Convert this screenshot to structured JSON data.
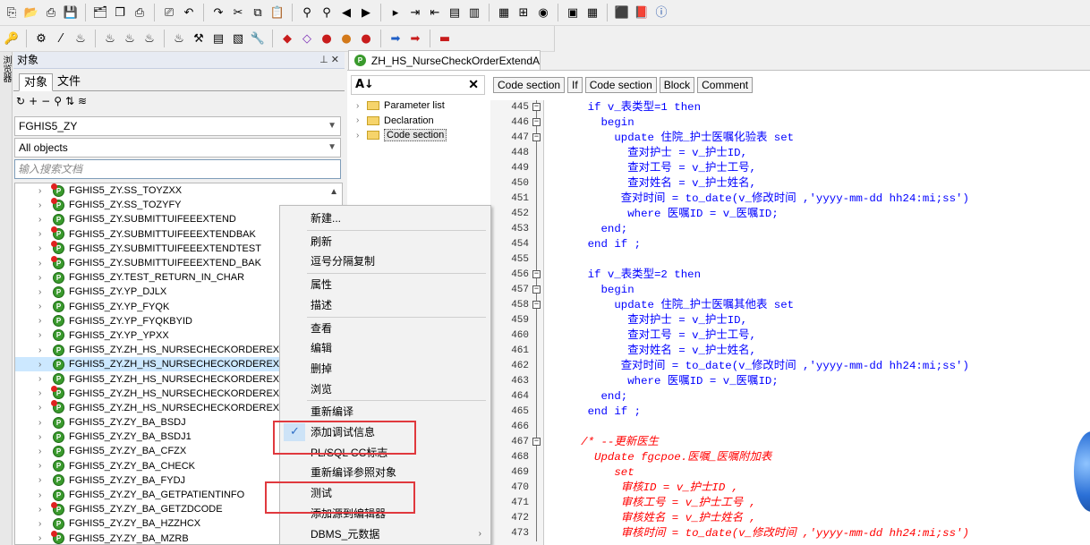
{
  "toolbar_top": {
    "icons": [
      "new-icon",
      "open-icon",
      "print-icon",
      "save-icon",
      "save-all-icon",
      "copy-window-icon",
      "print-preview-icon",
      "print-setup-icon",
      "undo-icon",
      "redo-icon",
      "cut-icon",
      "copy-icon",
      "paste-icon",
      "find-icon",
      "find-next-icon",
      "navigate-back-icon",
      "navigate-forward-icon",
      "execute-icon",
      "indent-icon",
      "unindent-icon",
      "comment-icon",
      "uncomment-icon",
      "describe-icon",
      "query-icon",
      "stop-icon",
      "window-list-icon",
      "tile-icon",
      "oracle-icon",
      "pdf-icon",
      "info-icon"
    ]
  },
  "toolbar_second": {
    "icons": [
      "key-icon",
      "compile-icon",
      "debug-icon",
      "breakpoint-icon",
      "connect-icon",
      "sql-icon",
      "beans-icon",
      "beans2-icon",
      "tools-icon",
      "report-icon",
      "docs-icon",
      "wrench-icon",
      "gem-icon",
      "diamond-icon",
      "ruby-icon",
      "ball-icon",
      "ball2-icon",
      "arrow-right-icon",
      "arrow-right-red-icon",
      "car-icon"
    ]
  },
  "side_tab": {
    "label": "浏览器"
  },
  "object_panel": {
    "title": "对象",
    "pin_icon": "pin-icon",
    "tabs": [
      "对象",
      "文件"
    ],
    "schema": "FGHIS5_ZY",
    "filter": "All objects",
    "search_placeholder": "输入搜索文档",
    "items": [
      {
        "name": "FGHIS5_ZY.SS_TOYZXX",
        "err": true
      },
      {
        "name": "FGHIS5_ZY.SS_TOZYFY",
        "err": true
      },
      {
        "name": "FGHIS5_ZY.SUBMITTUIFEEEXTEND",
        "err": false
      },
      {
        "name": "FGHIS5_ZY.SUBMITTUIFEEEXTENDBAK",
        "err": true
      },
      {
        "name": "FGHIS5_ZY.SUBMITTUIFEEEXTENDTEST",
        "err": true
      },
      {
        "name": "FGHIS5_ZY.SUBMITTUIFEEEXTEND_BAK",
        "err": true
      },
      {
        "name": "FGHIS5_ZY.TEST_RETURN_IN_CHAR",
        "err": false
      },
      {
        "name": "FGHIS5_ZY.YP_DJLX",
        "err": false
      },
      {
        "name": "FGHIS5_ZY.YP_FYQK",
        "err": false
      },
      {
        "name": "FGHIS5_ZY.YP_FYQKBYID",
        "err": false
      },
      {
        "name": "FGHIS5_ZY.YP_YPXX",
        "err": false
      },
      {
        "name": "FGHIS5_ZY.ZH_HS_NURSECHECKORDEREXTEN",
        "err": false
      },
      {
        "name": "FGHIS5_ZY.ZH_HS_NURSECHECKORDEREXTEN",
        "err": false,
        "selected": true
      },
      {
        "name": "FGHIS5_ZY.ZH_HS_NURSECHECKORDEREXTEN",
        "err": false
      },
      {
        "name": "FGHIS5_ZY.ZH_HS_NURSECHECKORDEREXTEN",
        "err": true
      },
      {
        "name": "FGHIS5_ZY.ZH_HS_NURSECHECKORDEREXTEN",
        "err": true
      },
      {
        "name": "FGHIS5_ZY.ZY_BA_BSDJ",
        "err": false
      },
      {
        "name": "FGHIS5_ZY.ZY_BA_BSDJ1",
        "err": false
      },
      {
        "name": "FGHIS5_ZY.ZY_BA_CFZX",
        "err": false
      },
      {
        "name": "FGHIS5_ZY.ZY_BA_CHECK",
        "err": false
      },
      {
        "name": "FGHIS5_ZY.ZY_BA_FYDJ",
        "err": false
      },
      {
        "name": "FGHIS5_ZY.ZY_BA_GETPATIENTINFO",
        "err": false
      },
      {
        "name": "FGHIS5_ZY.ZY_BA_GETZDCODE",
        "err": true
      },
      {
        "name": "FGHIS5_ZY.ZY_BA_HZZHCX",
        "err": false
      },
      {
        "name": "FGHIS5_ZY.ZY_BA_MZRB",
        "err": true
      }
    ]
  },
  "document_tab": {
    "title": "ZH_HS_NurseCheckOrderExtendA"
  },
  "structure": {
    "items": [
      "Parameter list",
      "Declaration",
      "Code section"
    ],
    "selected": 2
  },
  "section_bar": [
    "Code section",
    "If",
    "Code section",
    "Block",
    "Comment"
  ],
  "code": {
    "lines": [
      {
        "n": "445",
        "fold": "box",
        "text": "      if v_表类型=1 then",
        "cls": "kw-only"
      },
      {
        "n": "446",
        "fold": "box",
        "text": "        begin",
        "cls": "kw-only"
      },
      {
        "n": "447",
        "fold": "box",
        "text": "          update 住院_护士医嘱化验表 set",
        "cls": ""
      },
      {
        "n": "448",
        "fold": "line",
        "text": "            查对护士 = v_护士ID,",
        "cls": ""
      },
      {
        "n": "449",
        "fold": "line",
        "text": "            查对工号 = v_护士工号,",
        "cls": ""
      },
      {
        "n": "450",
        "fold": "line",
        "text": "            查对姓名 = v_护士姓名,",
        "cls": ""
      },
      {
        "n": "451",
        "fold": "line",
        "text": "           查对时间 = to_date(v_修改时间 ,'yyyy-mm-dd hh24:mi;ss')",
        "cls": ""
      },
      {
        "n": "452",
        "fold": "line",
        "text": "            where 医嘱ID = v_医嘱ID;",
        "cls": ""
      },
      {
        "n": "453",
        "fold": "line",
        "text": "        end;",
        "cls": ""
      },
      {
        "n": "454",
        "fold": "line",
        "text": "      end if ;",
        "cls": ""
      },
      {
        "n": "455",
        "fold": "line",
        "text": "",
        "cls": ""
      },
      {
        "n": "456",
        "fold": "box",
        "text": "      if v_表类型=2 then",
        "cls": "kw-only"
      },
      {
        "n": "457",
        "fold": "box",
        "text": "        begin",
        "cls": "kw-only"
      },
      {
        "n": "458",
        "fold": "box",
        "text": "          update 住院_护士医嘱其他表 set",
        "cls": ""
      },
      {
        "n": "459",
        "fold": "line",
        "text": "            查对护士 = v_护士ID,",
        "cls": ""
      },
      {
        "n": "460",
        "fold": "line",
        "text": "            查对工号 = v_护士工号,",
        "cls": ""
      },
      {
        "n": "461",
        "fold": "line",
        "text": "            查对姓名 = v_护士姓名,",
        "cls": ""
      },
      {
        "n": "462",
        "fold": "line",
        "text": "           查对时间 = to_date(v_修改时间 ,'yyyy-mm-dd hh24:mi;ss')",
        "cls": ""
      },
      {
        "n": "463",
        "fold": "line",
        "text": "            where 医嘱ID = v_医嘱ID;",
        "cls": ""
      },
      {
        "n": "464",
        "fold": "line",
        "text": "        end;",
        "cls": ""
      },
      {
        "n": "465",
        "fold": "line",
        "text": "      end if ;",
        "cls": ""
      },
      {
        "n": "466",
        "fold": "line",
        "text": "",
        "cls": ""
      },
      {
        "n": "467",
        "fold": "box",
        "text": "     /* --更新医生",
        "cls": "cmt"
      },
      {
        "n": "468",
        "fold": "line",
        "text": "       Update fgcpoe.医嘱_医嘱附加表",
        "cls": "cmt"
      },
      {
        "n": "469",
        "fold": "line",
        "text": "          set",
        "cls": "cmt"
      },
      {
        "n": "470",
        "fold": "line",
        "text": "           审核ID = v_护士ID ,",
        "cls": "cmt"
      },
      {
        "n": "471",
        "fold": "line",
        "text": "           审核工号 = v_护士工号 ,",
        "cls": "cmt"
      },
      {
        "n": "472",
        "fold": "line",
        "text": "           审核姓名 = v_护士姓名 ,",
        "cls": "cmt"
      },
      {
        "n": "473",
        "fold": "line",
        "text": "           审核时间 = to_date(v_修改时间 ,'yyyy-mm-dd hh24:mi;ss')",
        "cls": "cmt"
      }
    ]
  },
  "context_menu": {
    "items": [
      {
        "label": "新建...",
        "sep_after": true
      },
      {
        "label": "刷新"
      },
      {
        "label": "逗号分隔复制",
        "sep_after": true
      },
      {
        "label": "属性"
      },
      {
        "label": "描述",
        "sep_after": true
      },
      {
        "label": "查看"
      },
      {
        "label": "编辑"
      },
      {
        "label": "删掉"
      },
      {
        "label": "浏览",
        "sep_after": true
      },
      {
        "label": "重新编译"
      },
      {
        "label": "添加调试信息",
        "checked": true
      },
      {
        "label": "PL/SQL CC标志"
      },
      {
        "label": "重新编译参照对象"
      },
      {
        "label": "测试"
      },
      {
        "label": "添加源到编辑器"
      },
      {
        "label": "DBMS_元数据",
        "submenu": true
      }
    ]
  },
  "colors": {
    "keyword_blue": "#0000ff",
    "comment_red": "#ff0000",
    "highlight_box": "#e0393e",
    "object_green": "#3a9a2d"
  }
}
